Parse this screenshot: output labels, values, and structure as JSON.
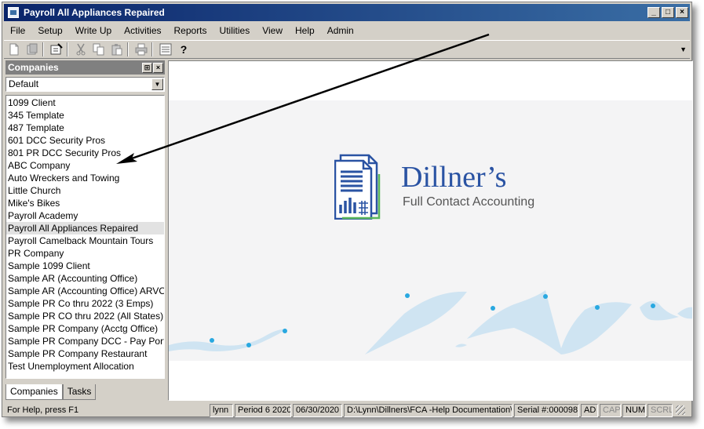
{
  "window": {
    "title": "Payroll All Appliances Repaired",
    "controls": [
      "_",
      "□",
      "×"
    ]
  },
  "menu": [
    "File",
    "Setup",
    "Write Up",
    "Activities",
    "Reports",
    "Utilities",
    "View",
    "Help",
    "Admin"
  ],
  "toolbar": {
    "help_glyph": "?"
  },
  "companies_panel": {
    "title": "Companies",
    "pin_glyph": "⊞",
    "close_glyph": "×",
    "filter_value": "Default",
    "items": [
      "1099 Client",
      "345 Template",
      "487 Template",
      "601 DCC Security Pros",
      "801 PR DCC Security Pros",
      "ABC Company",
      "Auto Wreckers and Towing",
      "Little Church",
      "Mike's Bikes",
      "Payroll Academy",
      "Payroll All Appliances Repaired",
      "Payroll Camelback Mountain Tours",
      "PR Company",
      "Sample 1099 Client",
      "Sample AR (Accounting Office)",
      "Sample AR (Accounting Office) ARVO",
      "Sample PR Co thru 2022 (3 Emps)",
      "Sample PR CO thru 2022 (All States)",
      "Sample PR Company (Acctg Office)",
      "Sample PR Company DCC - Pay Portals",
      "Sample PR Company Restaurant",
      "Test Unemployment Allocation"
    ],
    "selected_index": 10,
    "tabs": [
      "Companies",
      "Tasks"
    ]
  },
  "splash": {
    "brand": "Dillner’s",
    "subtitle": "Full Contact Accounting"
  },
  "status": {
    "help": "For Help, press F1",
    "user": "lynn",
    "period": "Period 6 2020",
    "date": "06/30/2020",
    "path": "D:\\Lynn\\Dillners\\FCA -Help Documentation\\",
    "serial": "Serial #:000098",
    "ad": "AD",
    "cap": "CAP",
    "num": "NUM",
    "scrl": "SCRL"
  },
  "colors": {
    "brand_blue": "#2a53a3",
    "title_bar": "#0a246a",
    "wave": "#cfe4f2",
    "wave_dot": "#29a8e0",
    "logo_green": "#5cb85c"
  }
}
